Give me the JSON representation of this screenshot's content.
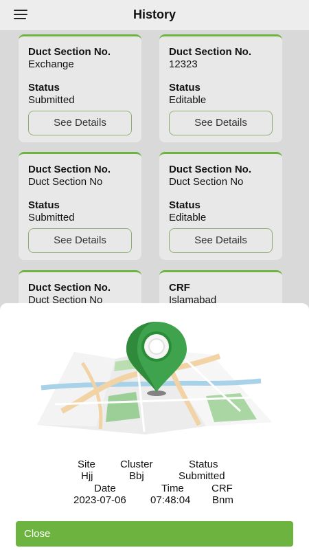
{
  "header": {
    "title": "History",
    "menu_icon": "hamburger-menu-icon"
  },
  "cards": [
    {
      "label1": "Duct Section No.",
      "value1": "Exchange",
      "label2": "Status",
      "value2": "Submitted",
      "button": "See Details"
    },
    {
      "label1": "Duct Section No.",
      "value1": "12323",
      "label2": "Status",
      "value2": "Editable",
      "button": "See Details"
    },
    {
      "label1": "Duct Section No.",
      "value1": "Duct Section No",
      "label2": "Status",
      "value2": "Submitted",
      "button": "See Details"
    },
    {
      "label1": "Duct Section No.",
      "value1": "Duct Section No",
      "label2": "Status",
      "value2": "Editable",
      "button": "See Details"
    },
    {
      "label1": "Duct Section No.",
      "value1": "Duct Section No"
    },
    {
      "label1": "CRF",
      "value1": "Islamabad"
    }
  ],
  "sheet": {
    "image_icon": "map-location-pin-icon",
    "site_label": "Site",
    "site_value": "Hjj",
    "cluster_label": "Cluster",
    "cluster_value": "Bbj",
    "status_label": "Status",
    "status_value": "Submitted",
    "date_label": "Date",
    "date_value": "2023-07-06",
    "time_label": "Time",
    "time_value": "07:48:04",
    "crf_label": "CRF",
    "crf_value": "Bnm",
    "close_label": "Close"
  },
  "colors": {
    "accent": "#6db33f",
    "card": "#e8e8e8",
    "background": "#d9d9d9"
  }
}
